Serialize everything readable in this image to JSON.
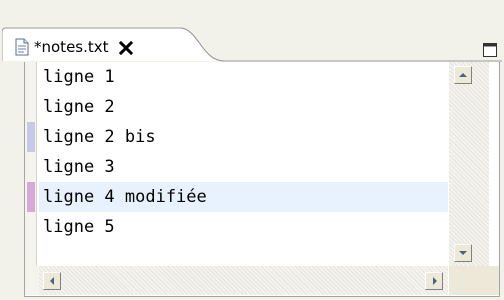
{
  "tab": {
    "title": "*notes.txt",
    "icon": "text-file-icon",
    "close_icon": "close-icon"
  },
  "view": {
    "maximize_icon": "maximize-icon"
  },
  "editor": {
    "lines": [
      {
        "text": "ligne 1",
        "change": "none"
      },
      {
        "text": "ligne 2",
        "change": "none"
      },
      {
        "text": "ligne 2 bis",
        "change": "added"
      },
      {
        "text": "ligne 3",
        "change": "none"
      },
      {
        "text": "ligne 4 modifiée",
        "change": "modified"
      },
      {
        "text": "ligne 5",
        "change": "none"
      }
    ],
    "current_line": 5
  },
  "colors": {
    "added_marker": "#c8c8e8",
    "modified_marker": "#d7a9d9",
    "current_line_highlight": "#e8f2fe"
  }
}
